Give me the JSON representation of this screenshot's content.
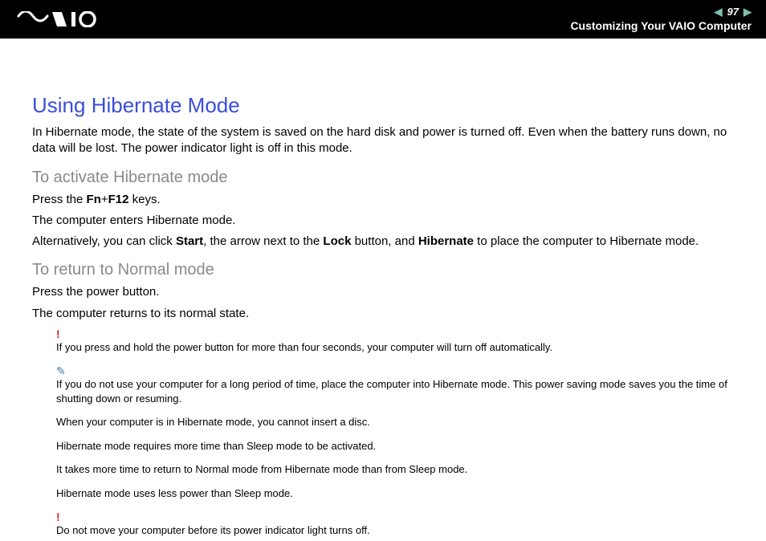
{
  "header": {
    "page_number": "97",
    "section": "Customizing Your VAIO Computer"
  },
  "title": "Using Hibernate Mode",
  "intro": "In Hibernate mode, the state of the system is saved on the hard disk and power is turned off. Even when the battery runs down, no data will be lost. The power indicator light is off in this mode.",
  "activate": {
    "heading": "To activate Hibernate mode",
    "line1_a": "Press the ",
    "line1_b": "Fn",
    "line1_c": "+",
    "line1_d": "F12",
    "line1_e": " keys.",
    "line2": "The computer enters Hibernate mode.",
    "line3_a": "Alternatively, you can click ",
    "line3_b": "Start",
    "line3_c": ", the arrow next to the ",
    "line3_d": "Lock",
    "line3_e": " button, and ",
    "line3_f": "Hibernate",
    "line3_g": " to place the computer to Hibernate mode."
  },
  "return": {
    "heading": "To return to Normal mode",
    "line1": "Press the power button.",
    "line2": "The computer returns to its normal state."
  },
  "notes": {
    "warn1": "If you press and hold the power button for more than four seconds, your computer will turn off automatically.",
    "tip1": "If you do not use your computer for a long period of time, place the computer into Hibernate mode. This power saving mode saves you the time of shutting down or resuming.",
    "tip2": "When your computer is in Hibernate mode, you cannot insert a disc.",
    "tip3": "Hibernate mode requires more time than Sleep mode to be activated.",
    "tip4": "It takes more time to return to Normal mode from Hibernate mode than from Sleep mode.",
    "tip5": "Hibernate mode uses less power than Sleep mode.",
    "warn2": "Do not move your computer before its power indicator light turns off."
  }
}
